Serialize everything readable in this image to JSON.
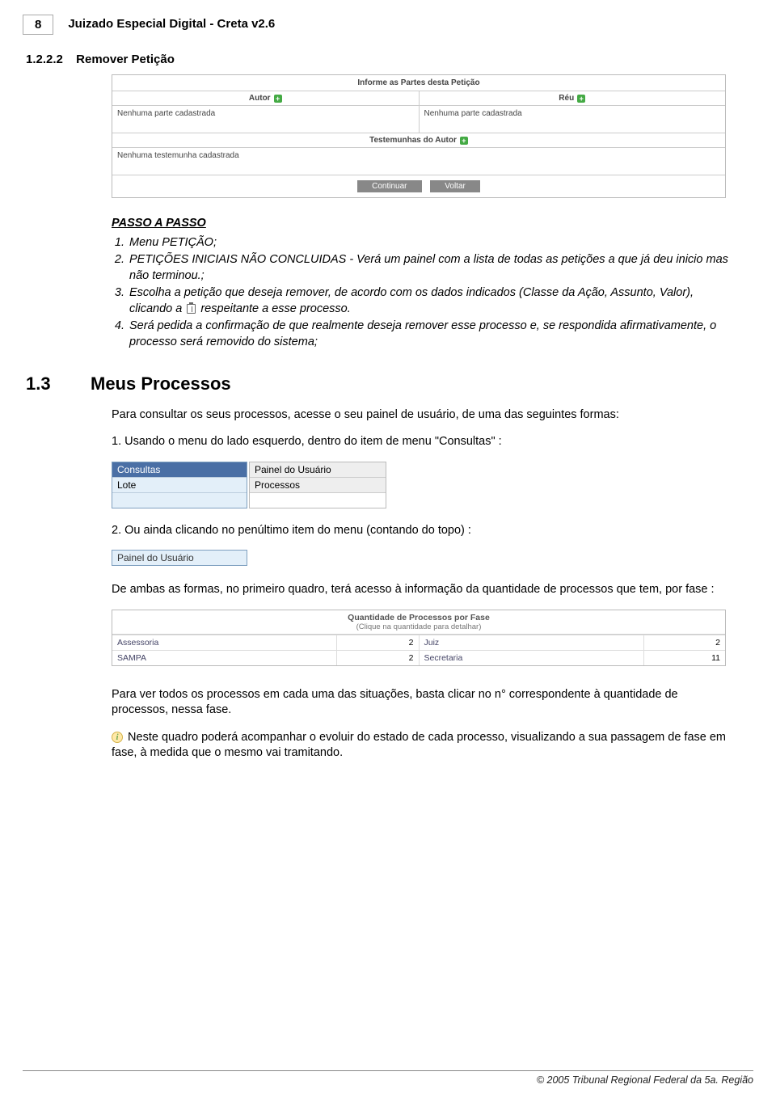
{
  "page_number": "8",
  "doc_title": "Juizado Especial Digital - Creta v2.6",
  "section_1222": {
    "num": "1.2.2.2",
    "title": "Remover Petição"
  },
  "form1": {
    "header": "Informe as Partes desta Petição",
    "autor_label": "Autor",
    "reu_label": "Réu",
    "none_text": "Nenhuma parte cadastrada",
    "test_header": "Testemunhas do Autor",
    "none_test": "Nenhuma testemunha cadastrada",
    "btn_continue": "Continuar",
    "btn_back": "Voltar"
  },
  "passo": {
    "header": "PASSO A PASSO",
    "s1": "Menu PETIÇÃO;",
    "s2": "PETIÇÕES INICIAIS NÃO CONCLUIDAS - Verá um painel com a lista de todas as petições a que já deu inicio mas não terminou.;",
    "s3a": "Escolha a petição que deseja remover, de acordo com os dados indicados (Classe da Ação, Assunto, Valor), clicando a ",
    "s3b": " respeitante a esse processo.",
    "s4": "Será pedida a confirmação de que realmente deseja remover esse processo e, se respondida afirmativamente, o processo será removido do sistema;"
  },
  "section_13": {
    "num": "1.3",
    "title": "Meus Processos"
  },
  "para_13_intro": "Para consultar os seus processos, acesse o seu painel de usuário, de uma das seguintes formas:",
  "opt1": "1. Usando o menu do lado esquerdo, dentro do item de menu \"Consultas\" :",
  "menu1": {
    "hd": "Consultas",
    "it1": "Lote",
    "sub1": "Painel do Usuário",
    "sub2": "Processos"
  },
  "opt2": "2. Ou ainda clicando no penúltimo item do menu (contando do topo) :",
  "menu2_item": "Painel do Usuário",
  "para_both": "De ambas as formas, no primeiro quadro, terá acesso à informação da quantidade de processos que tem, por fase :",
  "fase_table": {
    "title": "Quantidade de Processos por Fase",
    "subtitle": "(Clique na quantidade para detalhar)",
    "r1l": "Assessoria",
    "r1n": "2",
    "r1l2": "Juiz",
    "r1n2": "2",
    "r2l": "SAMPA",
    "r2n": "2",
    "r2l2": "Secretaria",
    "r2n2": "11"
  },
  "para_click_n": "Para ver todos os processos em cada uma das situações, basta clicar no n° correspondente à quantidade de processos, nessa fase.",
  "para_info": "Neste quadro poderá acompanhar o evoluir do estado de cada processo, visualizando a sua passagem de fase em fase, à medida que o mesmo vai tramitando.",
  "footer": "© 2005 Tribunal Regional Federal da 5a. Região"
}
